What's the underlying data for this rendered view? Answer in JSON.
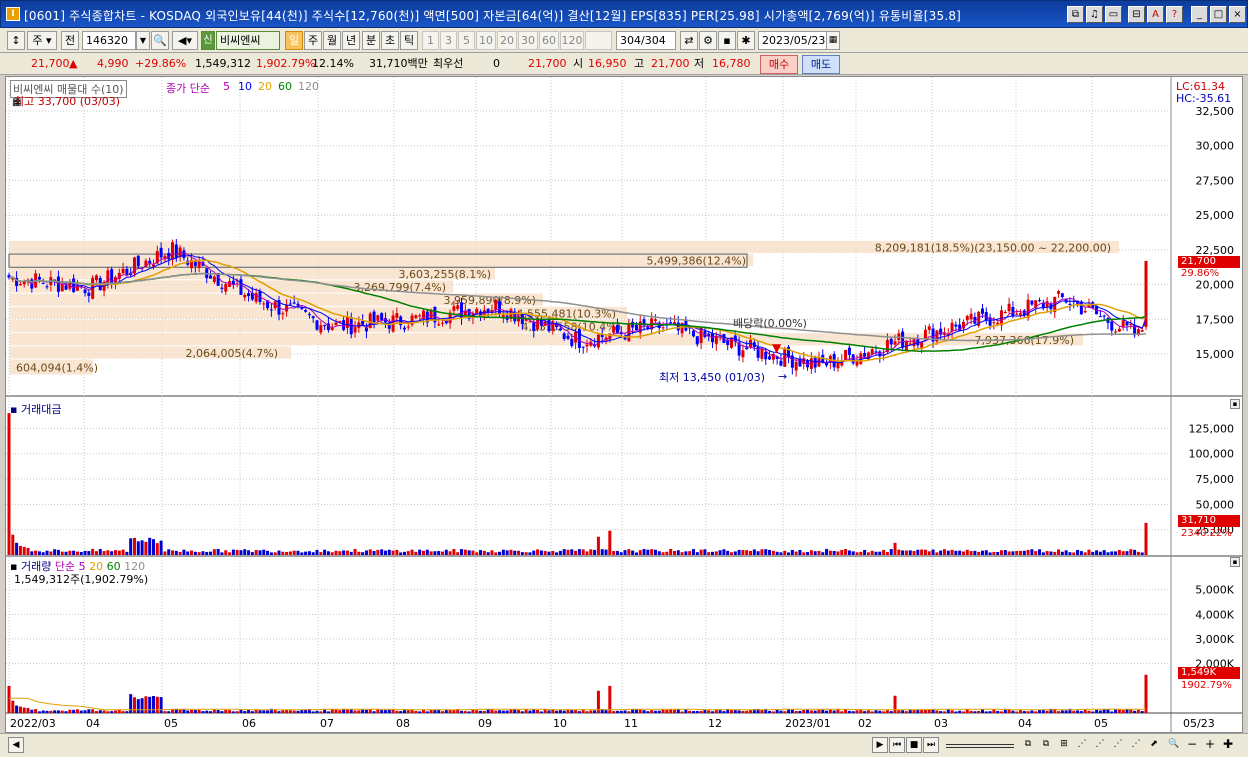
{
  "window": {
    "title": "[0601] 주식종합차트 - KOSDAQ 외국인보유[44(천)] 주식수[12,760(천)] 액면[500] 자본금[64(억)] 결산[12월] EPS[835] PER[25.98] 시가총액[2,769(억)] 유통비율[35.8]",
    "buttons": [
      "⧉",
      "♫",
      "▭",
      "⊟",
      "A",
      "?",
      "_",
      "□",
      "×"
    ]
  },
  "toolbar": {
    "market": "주",
    "prev_label": "전",
    "code": "146320",
    "name_badge": "신",
    "stock_name": "비씨엔씨",
    "periods": [
      "일",
      "주",
      "월",
      "년",
      "분",
      "초",
      "틱"
    ],
    "active_period": "일",
    "intervals": [
      "1",
      "3",
      "5",
      "10",
      "20",
      "30",
      "60",
      "120"
    ],
    "page_count": "304",
    "page_total": "/304",
    "date": "2023/05/23"
  },
  "quote": {
    "price": "21,700",
    "arrow": "▲",
    "change": "4,990",
    "change_pct": "+29.86%",
    "volume": "1,549,312",
    "volume_pct": "1,902.79%",
    "turnover_pct": "12.14%",
    "amount": "31,710백만",
    "bid_label": "최우선",
    "bid_qty": "0",
    "bid_price": "21,700",
    "open_label": "시",
    "open": "16,950",
    "high_label": "고",
    "high": "21,700",
    "low_label": "저",
    "low": "16,780",
    "buy_label": "매수",
    "sell_label": "매도"
  },
  "price_panel": {
    "legend_box": "비씨엔씨 매물대 수(10)",
    "ma_label": "종가 단순",
    "ma_periods": [
      "5",
      "10",
      "20",
      "60",
      "120"
    ],
    "ma_colors": [
      "#b000b0",
      "#0000ff",
      "#e0a000",
      "#008000",
      "#909090"
    ],
    "high_marker": "최고 33,700 (03/03)",
    "low_marker": "최저 13,450 (01/03)",
    "dividend": "배당락(0.00%)",
    "lc": "LC:61.34",
    "hc": "HC:-35.61",
    "last_price": "21,700",
    "last_pct": "29.86%",
    "y_ticks": [
      "32,500",
      "30,000",
      "27,500",
      "25,000",
      "22,500",
      "20,000",
      "17,500",
      "15,000"
    ],
    "volume_profile": [
      {
        "label": "8,209,181(18.5%)(23,150.00 ~ 22,200.00)",
        "price_lo": 22200,
        "price_hi": 23150,
        "share": 18.5
      },
      {
        "label": "5,499,386(12.4%)",
        "price_lo": 21250,
        "price_hi": 22200,
        "share": 12.4
      },
      {
        "label": "3,603,255(8.1%)",
        "price_lo": 20300,
        "price_hi": 21250,
        "share": 8.1
      },
      {
        "label": "3,269,799(7.4%)",
        "price_lo": 19350,
        "price_hi": 20300,
        "share": 7.4
      },
      {
        "label": "3,959,890(8.9%)",
        "price_lo": 18400,
        "price_hi": 19350,
        "share": 8.9
      },
      {
        "label": "4,555,481(10.3%)",
        "price_lo": 17450,
        "price_hi": 18400,
        "share": 10.3
      },
      {
        "label": "4,631,558(10.4%)",
        "price_lo": 16500,
        "price_hi": 17450,
        "share": 10.4
      },
      {
        "label": "7,937,366(17.9%)",
        "price_lo": 15550,
        "price_hi": 16500,
        "share": 17.9
      },
      {
        "label": "2,064,005(4.7%)",
        "price_lo": 14600,
        "price_hi": 15550,
        "share": 4.7
      },
      {
        "label": "604,094(1.4%)",
        "price_lo": 13450,
        "price_hi": 14600,
        "share": 1.4
      }
    ]
  },
  "amount_panel": {
    "title": "거래대금",
    "last_value": "31,710",
    "last_pct": "2340.22%",
    "y_ticks": [
      "125,000",
      "100,000",
      "75,000",
      "50,000",
      "25,000"
    ]
  },
  "volume_panel": {
    "title": "거래량",
    "ma_label": "단순",
    "ma_periods": [
      "5",
      "20",
      "60",
      "120"
    ],
    "sub_label": "1,549,312주(1,902.79%)",
    "last_value": "1,549K",
    "last_pct": "1902.79%",
    "y_ticks": [
      "5,000K",
      "4,000K",
      "3,000K",
      "2,000K"
    ]
  },
  "x_axis": [
    "2022/03",
    "04",
    "05",
    "06",
    "07",
    "08",
    "09",
    "10",
    "11",
    "12",
    "2023/01",
    "02",
    "03",
    "04",
    "05",
    "05/23"
  ],
  "chart_data": {
    "type": "candlestick",
    "x": [
      "2022/03",
      "04",
      "05",
      "06",
      "07",
      "08",
      "09",
      "10",
      "11",
      "12",
      "2023/01",
      "02",
      "03",
      "04",
      "05",
      "05/23"
    ],
    "close_approx": [
      20500,
      19800,
      22500,
      19000,
      17000,
      17500,
      18500,
      16000,
      17000,
      15500,
      14200,
      16000,
      17500,
      19000,
      16000,
      21700
    ],
    "ylim": [
      13000,
      33700
    ],
    "y_ticks": [
      15000,
      17500,
      20000,
      22500,
      25000,
      27500,
      30000,
      32500
    ]
  }
}
